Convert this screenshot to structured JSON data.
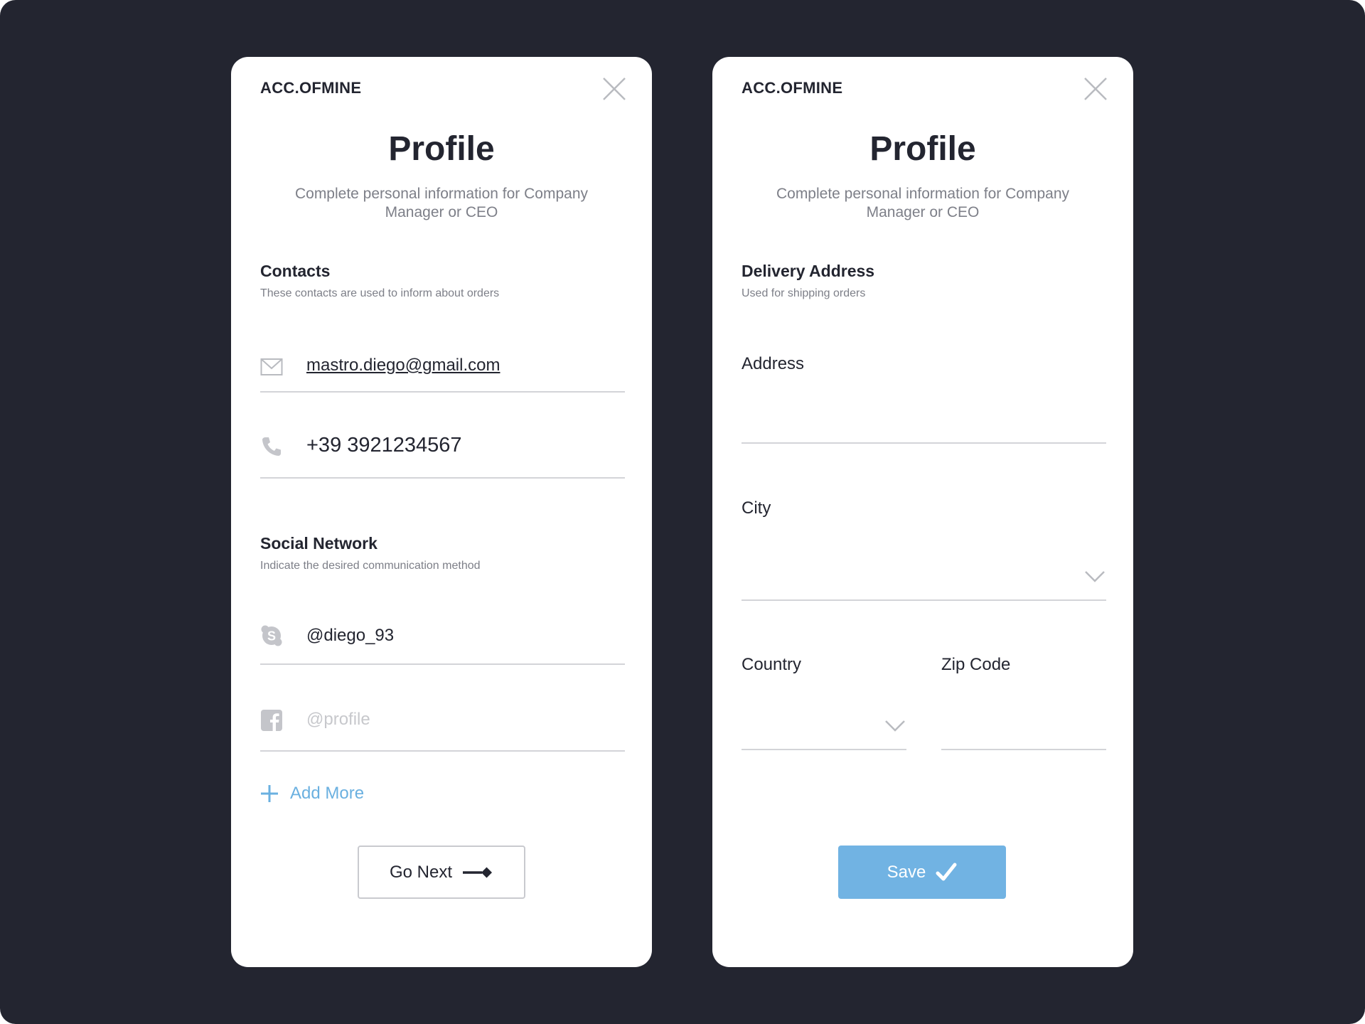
{
  "left_card": {
    "brand": "ACC.OFMINE",
    "title": "Profile",
    "subtitle": "Complete personal information for Company Manager or CEO",
    "contacts": {
      "title": "Contacts",
      "description": "These contacts are used to inform about orders",
      "email": "mastro.diego@gmail.com",
      "phone": "+39 3921234567"
    },
    "social": {
      "title": "Social Network",
      "description": "Indicate the desired communication method",
      "skype": "@diego_93",
      "facebook_placeholder": "@profile"
    },
    "add_more_label": "Add More",
    "next_label": "Go Next"
  },
  "right_card": {
    "brand": "ACC.OFMINE",
    "title": "Profile",
    "subtitle": "Complete personal information for Company Manager or CEO",
    "delivery": {
      "title": "Delivery Address",
      "description": "Used for shipping orders"
    },
    "address_label": "Address",
    "city_label": "City",
    "country_label": "Country",
    "zip_label": "Zip Code",
    "save_label": "Save"
  },
  "colors": {
    "background": "#232530",
    "accent": "#71b3e3",
    "text": "#232530",
    "muted": "#7d7f88",
    "line": "#d3d4d8"
  },
  "icons": [
    "close-icon",
    "mail-icon",
    "phone-icon",
    "skype-icon",
    "facebook-icon",
    "plus-icon",
    "arrow-right-icon",
    "chevron-down-icon",
    "check-icon"
  ]
}
